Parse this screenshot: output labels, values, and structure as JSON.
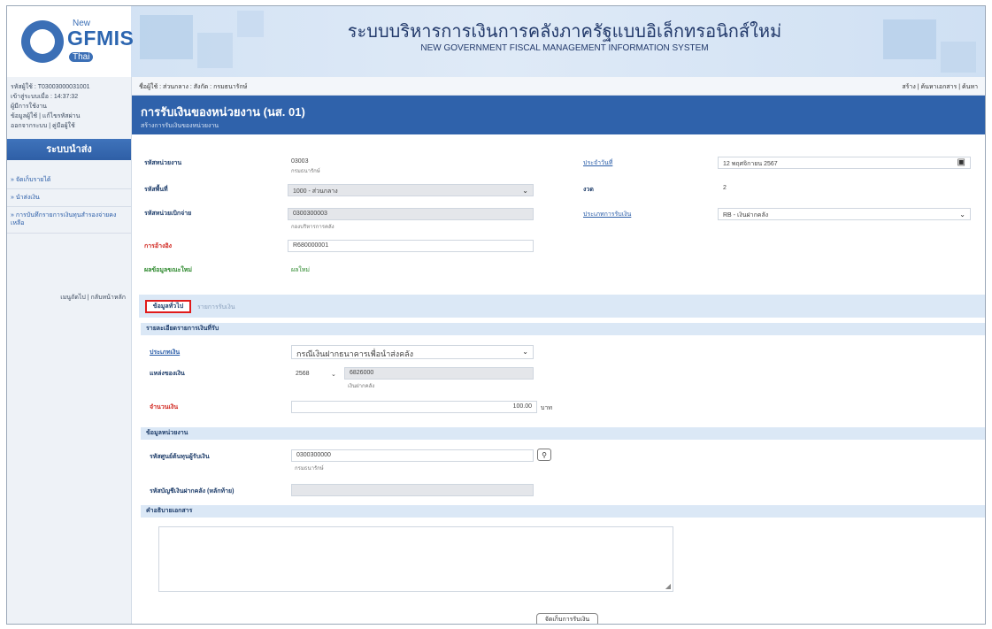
{
  "header": {
    "logo_new": "New",
    "logo_gfmis": "GFMIS",
    "logo_thai": "Thai",
    "title_th": "ระบบบริหารการเงินการคลังภาครัฐแบบอิเล็กทรอนิกส์ใหม่",
    "title_en": "NEW GOVERNMENT FISCAL MANAGEMENT INFORMATION SYSTEM"
  },
  "sidebar": {
    "user_code": "รหัสผู้ใช้ : T03003000031001",
    "time_left": "เข้าสู่ระบบเมื่อ : 14:37:32",
    "line3": "ผู้มีการใช้งาน",
    "line4": "ข้อมูลผู้ใช้ | แก้ไขรหัสผ่าน",
    "line5": "ออกจากระบบ | คู่มือผู้ใช้",
    "menu_title": "ระบบนำส่ง",
    "items": [
      "» จัดเก็บรายได้",
      "» นำส่งเงิน",
      "» การบันทึกรายการเงินทุนสำรองจ่ายคงเหลือ"
    ],
    "bottom_links": "เมนูถัดไป | กลับหน้าหลัก"
  },
  "topbar": {
    "breadcrumb": "ชื่อผู้ใช้ : ส่วนกลาง : สังกัด : กรมธนารักษ์",
    "links": "สร้าง | ค้นหาเอกสาร | ค้นหา"
  },
  "page": {
    "title": "การรับเงินของหน่วยงาน (นส. 01)",
    "subtitle": "สร้างการรับเงินของหน่วยงาน"
  },
  "form": {
    "agency_label": "รหัสหน่วยงาน",
    "agency_code": "03003",
    "agency_name": "กรมธนารักษ์",
    "area_label": "รหัสพื้นที่",
    "area_value": "1000 - ส่วนกลาง",
    "disburse_label": "รหัสหน่วยเบิกจ่าย",
    "disburse_code": "0300300003",
    "disburse_name": "กองบริหารการคลัง",
    "ref_label": "การอ้างอิง",
    "ref_value": "R680000001",
    "status_label": "ผลข้อมูลขณะใหม่",
    "status_value": "ผลใหม่",
    "doc_date_label": "ประจำวันที่",
    "doc_date_value": "12 พฤศจิกายน 2567",
    "period_label": "งวด",
    "period_value": "2",
    "rtype_label": "ประเภทการรับเงิน",
    "rtype_value": "RB - เงินฝากคลัง"
  },
  "tabs": {
    "active": "ข้อมูลทั่วไป",
    "inactive": "รายการรับเงิน"
  },
  "details": {
    "section_title": "รายละเอียดรายการเงินที่รับ",
    "type_label": "ประเภทเงิน",
    "type_value": "กรณีเงินฝากธนาคารเพื่อนำส่งคลัง",
    "source_label": "แหล่งของเงิน",
    "source_year": "2568",
    "source_code": "6826000",
    "source_desc": "เงินฝากคลัง",
    "amount_label": "จำนวนเงิน",
    "amount_value": "100.00",
    "currency": "บาท"
  },
  "agency_info": {
    "section_title": "ข้อมูลหน่วยงาน",
    "cost_center_label": "รหัสศูนย์ต้นทุนผู้รับเงิน",
    "cost_center_value": "0300300000",
    "cost_center_name": "กรมธนารักษ์",
    "deposit_label": "รหัสบัญชีเงินฝากคลัง (หลักท้าย)",
    "deposit_value": ""
  },
  "notes": {
    "section_title": "คำอธิบายเอกสาร",
    "text": ""
  },
  "actions": {
    "next_button": "จัดเก็บการรับเงิน"
  }
}
